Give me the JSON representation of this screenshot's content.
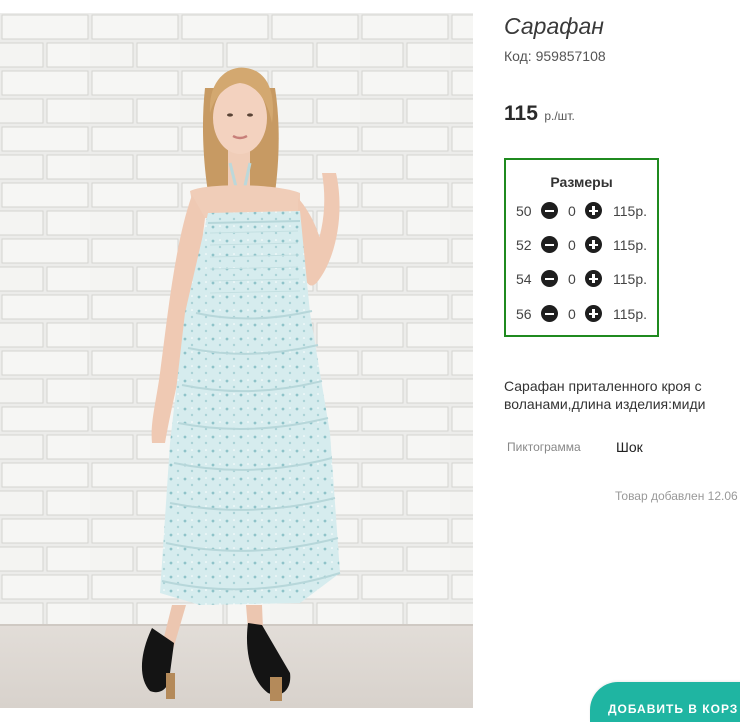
{
  "product": {
    "title": "Сарафан",
    "code": "Код: 959857108",
    "price": "115",
    "price_unit": "р./шт.",
    "description": "Сарафан приталенного кроя с воланами,длина изделия:миди",
    "pictogram_label": "Пиктограмма",
    "pictogram_value": "Шок",
    "added_text": "Товар добавлен 12.06"
  },
  "sizes": {
    "title": "Размеры",
    "rows": [
      {
        "size": "50",
        "qty": "0",
        "price": "115р."
      },
      {
        "size": "52",
        "qty": "0",
        "price": "115р."
      },
      {
        "size": "54",
        "qty": "0",
        "price": "115р."
      },
      {
        "size": "56",
        "qty": "0",
        "price": "115р."
      }
    ]
  },
  "action_button": {
    "label": "ДОБАВИТЬ В КОРЗ"
  },
  "colors": {
    "sizes_border": "#1f8a1f",
    "action_button": "#1fb5a2",
    "dress": "#cfe6e8"
  },
  "icons": {
    "minus": "minus-circle-icon",
    "plus": "plus-circle-icon"
  }
}
